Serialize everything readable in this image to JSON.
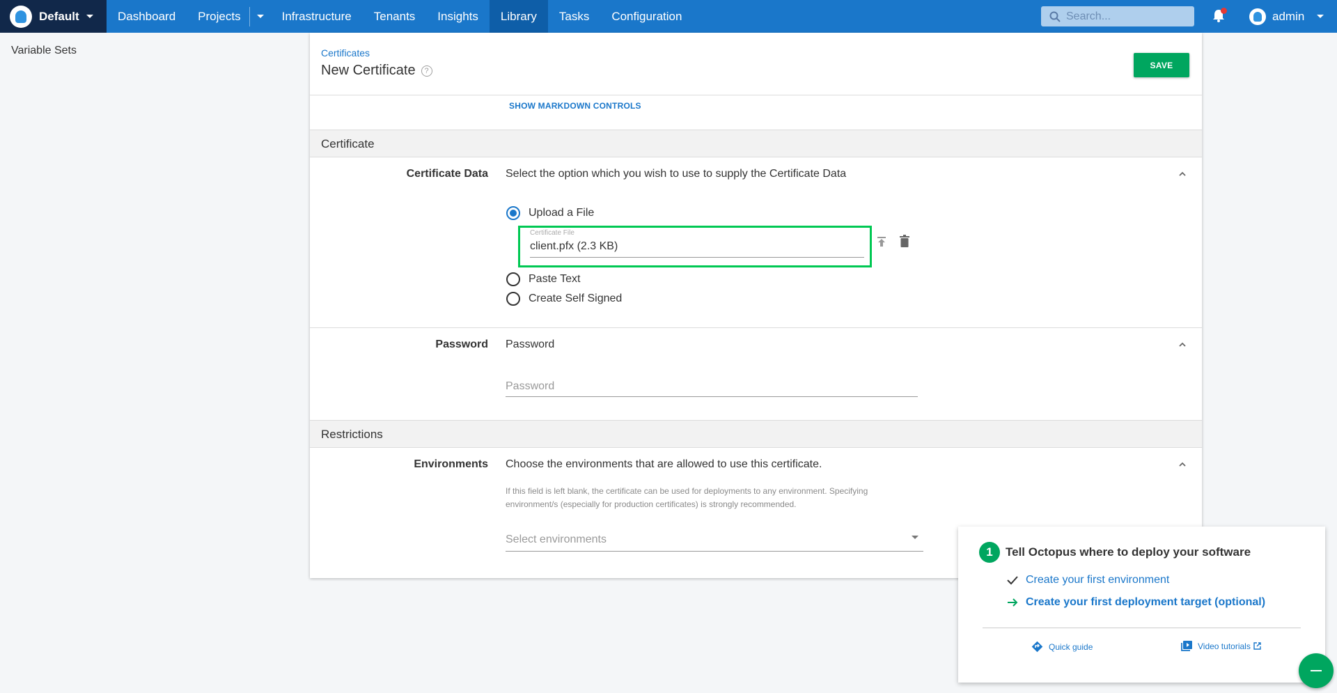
{
  "nav": {
    "space": "Default",
    "items": [
      "Dashboard",
      "Projects",
      "Infrastructure",
      "Tenants",
      "Insights",
      "Library",
      "Tasks",
      "Configuration"
    ],
    "active": "Library",
    "search_placeholder": "Search...",
    "user": "admin"
  },
  "sidebar": {
    "link": "Variable Sets"
  },
  "header": {
    "breadcrumb": "Certificates",
    "title": "New Certificate",
    "save_label": "SAVE"
  },
  "markdown_link": "SHOW MARKDOWN CONTROLS",
  "sections": {
    "certificate": "Certificate",
    "restrictions": "Restrictions"
  },
  "certificate_data": {
    "label": "Certificate Data",
    "summary": "Select the option which you wish to use to supply the Certificate Data",
    "options": [
      "Upload a File",
      "Paste Text",
      "Create Self Signed"
    ],
    "selected": "Upload a File",
    "file_field_label": "Certificate File",
    "file_value": "client.pfx (2.3 KB)"
  },
  "password": {
    "label": "Password",
    "summary": "Password",
    "placeholder": "Password"
  },
  "environments": {
    "label": "Environments",
    "summary": "Choose the environments that are allowed to use this certificate.",
    "hint": "If this field is left blank, the certificate can be used for deployments to any environment. Specifying environment/s (especially for production certificates) is strongly recommended.",
    "placeholder": "Select environments"
  },
  "onboarding": {
    "step_number": "1",
    "title": "Tell Octopus where to deploy your software",
    "steps": [
      "Create your first environment",
      "Create your first deployment target (optional)"
    ],
    "quick_guide": "Quick guide",
    "video_tutorials": "Video tutorials"
  },
  "colors": {
    "nav": "#1a77ca",
    "space": "#11284a",
    "accent": "#00a65f",
    "highlight": "#00c853"
  }
}
